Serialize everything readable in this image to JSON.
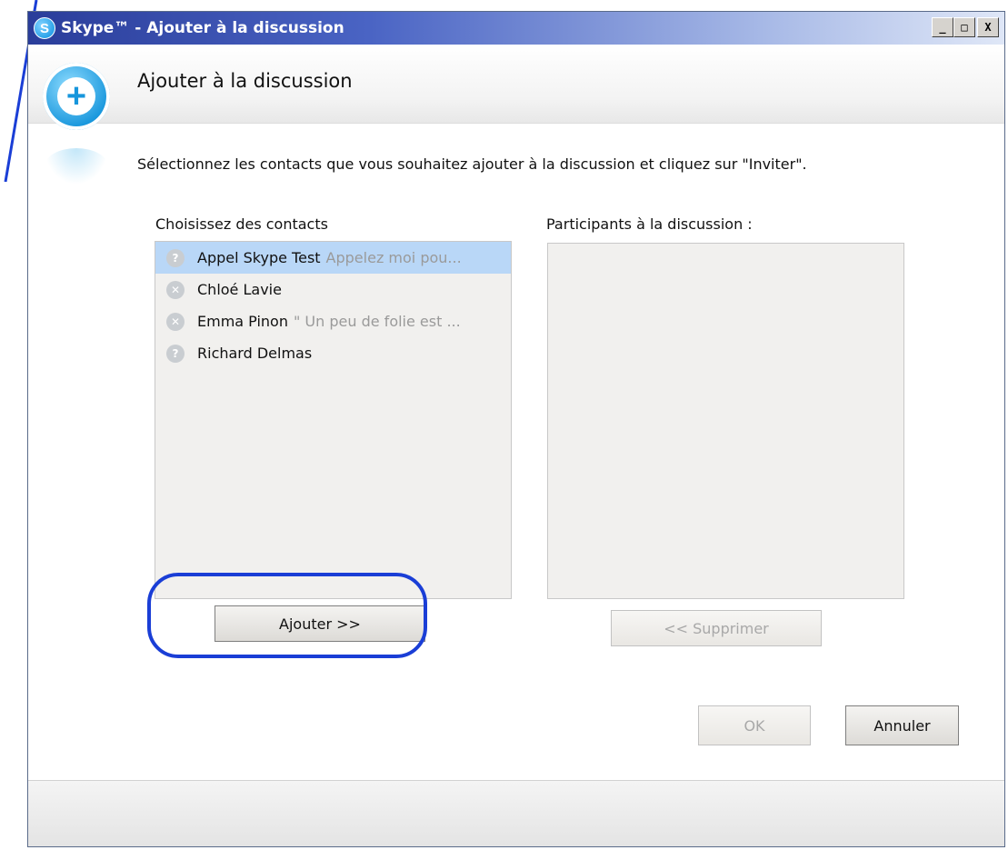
{
  "window": {
    "title": "Skype™ - Ajouter à la discussion",
    "logo_letter": "S",
    "controls": {
      "minimize": "_",
      "maximize": "□",
      "close": "X"
    }
  },
  "dialog": {
    "heading": "Ajouter à la discussion",
    "instruction": "Sélectionnez les contacts que vous souhaitez ajouter à la discussion et cliquez sur \"Inviter\".",
    "icon": "add-chat-icon"
  },
  "contacts": {
    "label": "Choisissez des contacts",
    "items": [
      {
        "name": "Appel Skype Test",
        "mood": "Appelez moi pou...",
        "status_icon": "status-unknown-icon",
        "selected": true
      },
      {
        "name": "Chloé Lavie",
        "mood": "",
        "status_icon": "status-offline-icon",
        "selected": false
      },
      {
        "name": "Emma Pinon",
        "mood": "\" Un peu de folie est ...",
        "status_icon": "status-offline-icon",
        "selected": false
      },
      {
        "name": "Richard Delmas",
        "mood": "",
        "status_icon": "status-unknown-icon",
        "selected": false
      }
    ]
  },
  "participants": {
    "label": "Participants à la discussion :",
    "items": []
  },
  "buttons": {
    "add": "Ajouter >>",
    "remove": "<< Supprimer",
    "ok": "OK",
    "cancel": "Annuler"
  },
  "colors": {
    "titlebar_start": "#2a3d9a",
    "selection": "#b9d7f7",
    "annotation": "#1a3ed6",
    "icon_blue": "#1796dc"
  }
}
